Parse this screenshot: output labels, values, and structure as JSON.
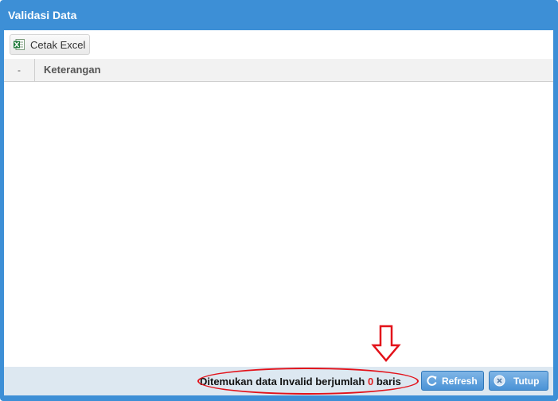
{
  "window": {
    "title": "Validasi Data"
  },
  "toolbar": {
    "excel_label": "Cetak Excel"
  },
  "grid": {
    "columns": [
      "-",
      "Keterangan"
    ],
    "rows": []
  },
  "footer": {
    "status_prefix": "Ditemukan data Invalid berjumlah",
    "invalid_count": "0",
    "status_suffix": "baris",
    "refresh_label": "Refresh",
    "close_label": "Tutup"
  },
  "colors": {
    "accent": "#3d8fd6",
    "annotation": "#e3121a",
    "count": "#e02020",
    "excel_green": "#1f7a3a"
  },
  "icons": {
    "excel": "excel-icon",
    "refresh": "refresh-icon",
    "close": "close-circle-icon",
    "annotation_arrow": "down-arrow-icon"
  }
}
